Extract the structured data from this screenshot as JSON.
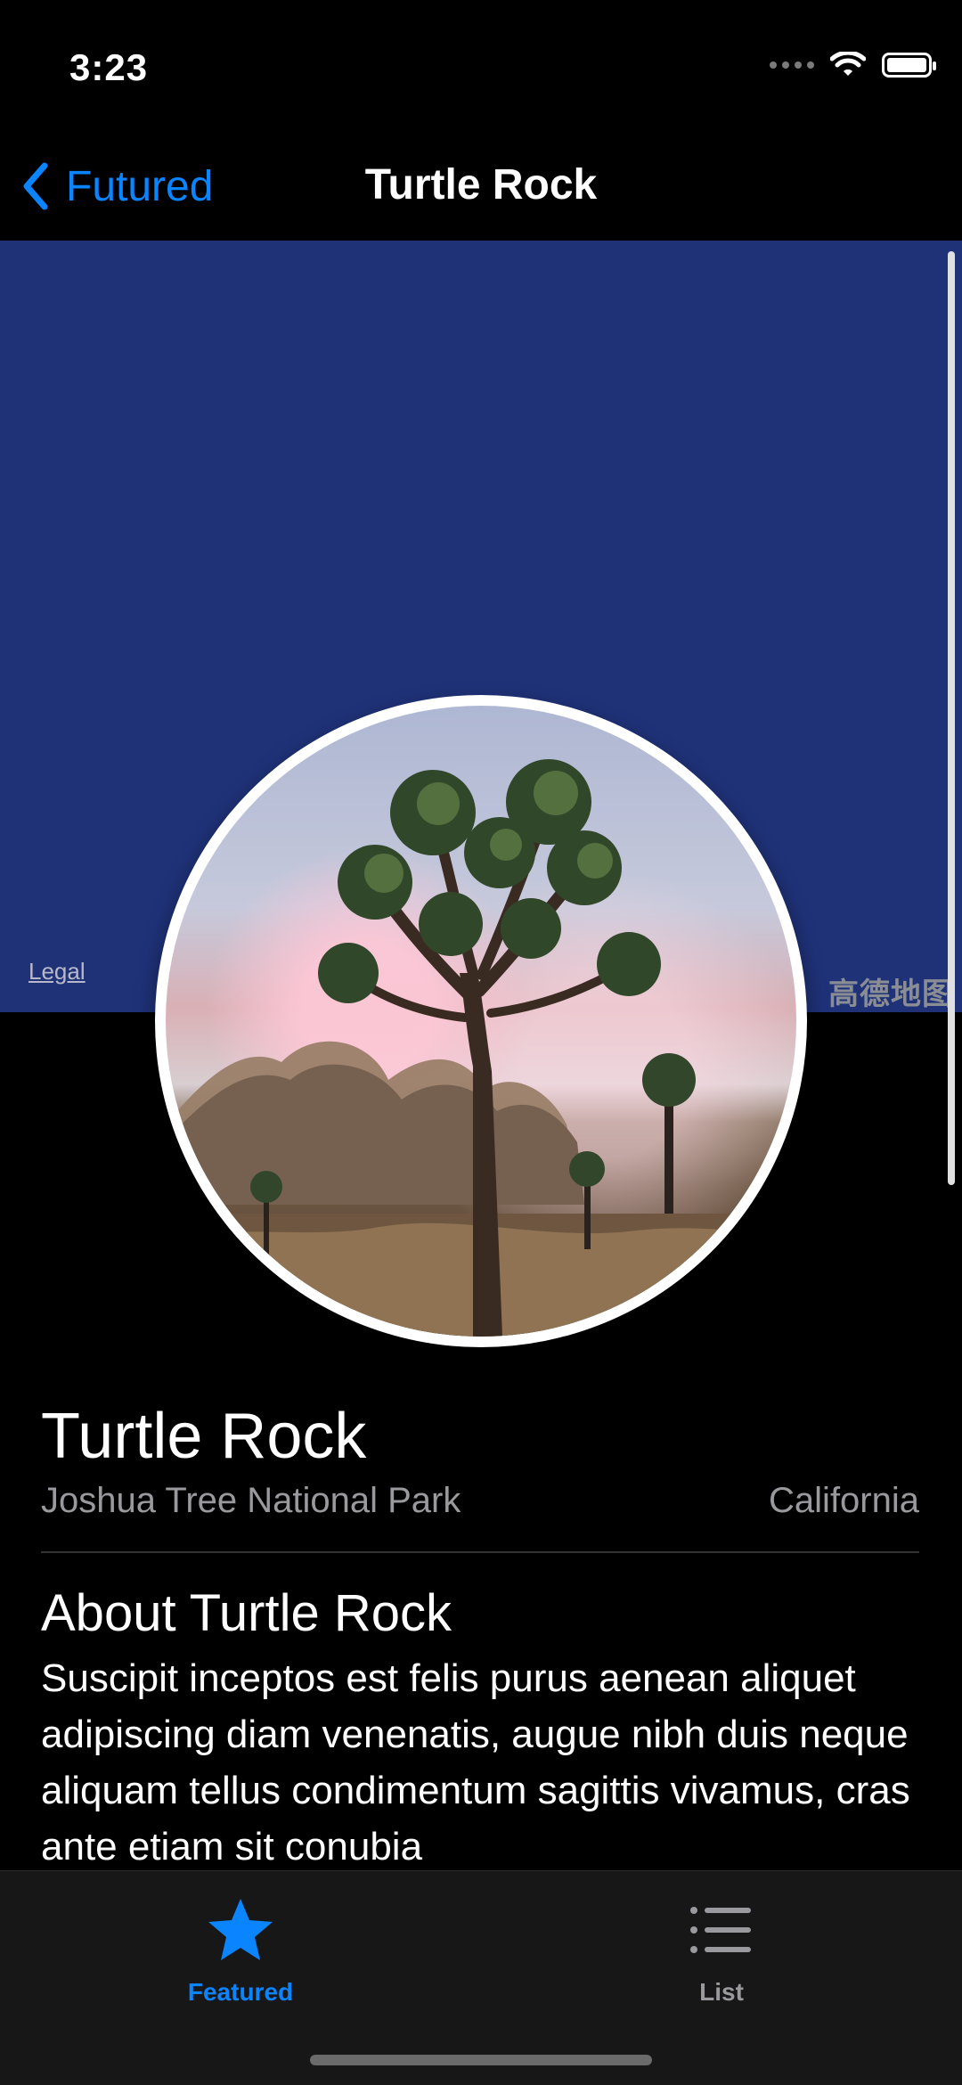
{
  "status_bar": {
    "time": "3:23",
    "icons": [
      "signal-dots",
      "wifi-icon",
      "battery-icon"
    ]
  },
  "nav": {
    "back_label": "Futured",
    "title": "Turtle Rock",
    "accent": "#0a84ff"
  },
  "map": {
    "legal_label": "Legal",
    "provider_label": "高德地图",
    "background": "#1f3278"
  },
  "landmark": {
    "name": "Turtle Rock",
    "park": "Joshua Tree National Park",
    "state": "California",
    "about_title": "About Turtle Rock",
    "description": "Suscipit inceptos est felis purus aenean aliquet adipiscing diam venenatis, augue nibh duis neque aliquam tellus condimentum sagittis vivamus, cras ante etiam sit conubia"
  },
  "tabs": [
    {
      "label": "Featured",
      "icon": "star-icon",
      "active": true
    },
    {
      "label": "List",
      "icon": "list-icon",
      "active": false
    }
  ]
}
